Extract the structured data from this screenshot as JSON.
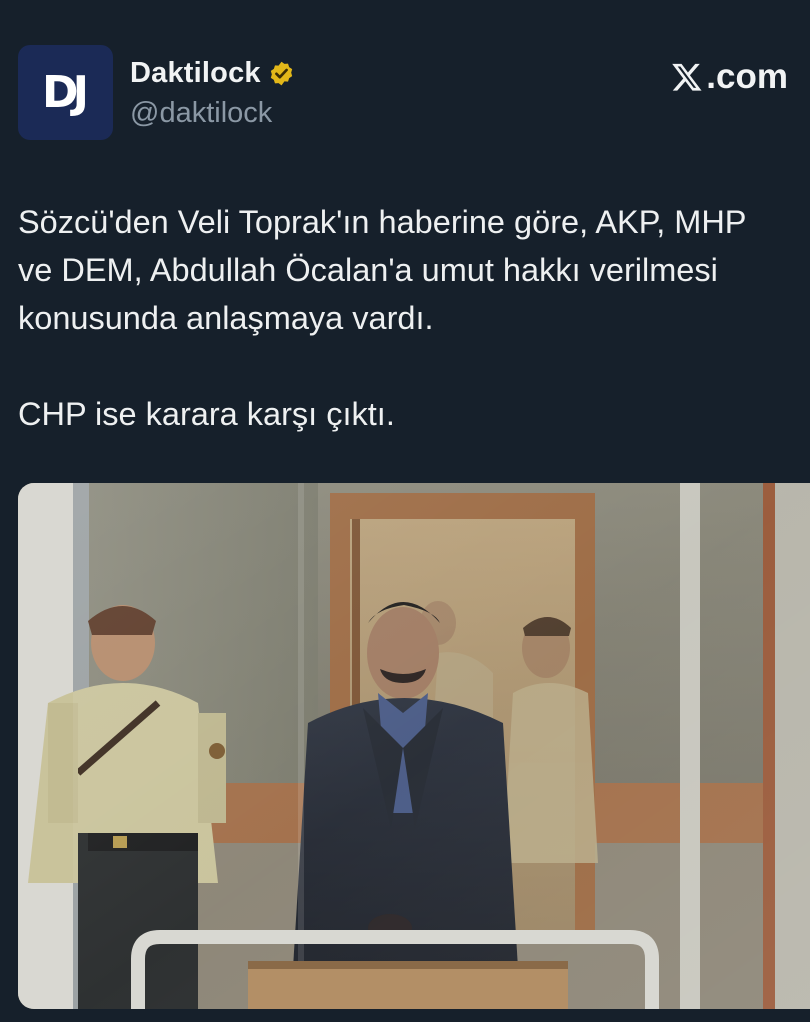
{
  "account": {
    "avatar_text": "DJ",
    "display_name": "Daktilock",
    "handle": "@daktilock",
    "verified_icon": "verified-badge-icon"
  },
  "brand": {
    "label": ".com",
    "icon": "x-logo-icon"
  },
  "tweet": {
    "paragraph_1": "Sözcü'den Veli Toprak'ın haberine göre, AKP, MHP ve DEM, Abdullah Öcalan'a umut hakkı verilmesi konusunda anlaşmaya vardı.",
    "paragraph_2": "CHP ise karara karşı çıktı."
  },
  "colors": {
    "background": "#16202b",
    "text": "#e7e9ea",
    "muted": "#8b98a5",
    "verified": "#e2b719",
    "avatar": "#1b2a56"
  }
}
